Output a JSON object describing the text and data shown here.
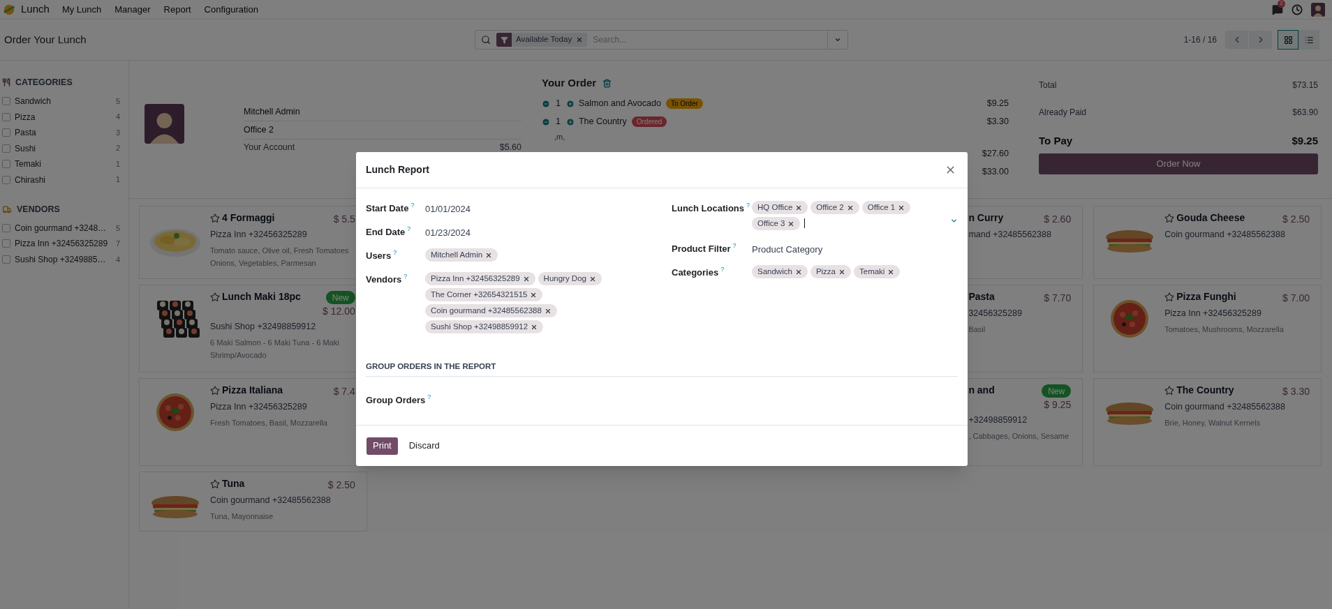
{
  "navbar": {
    "app": "Lunch",
    "menu": [
      "My Lunch",
      "Manager",
      "Report",
      "Configuration"
    ],
    "messages_badge": "2"
  },
  "control_panel": {
    "title": "Order Your Lunch",
    "search": {
      "facet": "Available Today",
      "placeholder": "Search..."
    },
    "pager": "1-16 / 16",
    "views": [
      {
        "kind": "kanban",
        "selected": true
      },
      {
        "kind": "list",
        "selected": false
      }
    ]
  },
  "sidebar": {
    "sections": [
      {
        "kind": "categories",
        "title": "CATEGORIES",
        "items": [
          {
            "label": "Sandwich",
            "count": "5",
            "checked": false
          },
          {
            "label": "Pizza",
            "count": "4",
            "checked": false
          },
          {
            "label": "Pasta",
            "count": "3",
            "checked": false
          },
          {
            "label": "Sushi",
            "count": "2",
            "checked": false
          },
          {
            "label": "Temaki",
            "count": "1",
            "checked": false
          },
          {
            "label": "Chirashi",
            "count": "1",
            "checked": false
          }
        ]
      },
      {
        "kind": "vendors",
        "title": "VENDORS",
        "items": [
          {
            "label": "Coin gourmand +3248…",
            "count": "5",
            "checked": false
          },
          {
            "label": "Pizza Inn +32456325289",
            "count": "7",
            "checked": false
          },
          {
            "label": "Sushi Shop +3249885…",
            "count": "4",
            "checked": false
          }
        ]
      }
    ]
  },
  "user": {
    "name": "Mitchell Admin",
    "location": "Office 2",
    "account_label": "Your Account",
    "account": "$5.60"
  },
  "order": {
    "title": "Your Order",
    "lines": [
      {
        "kind": "item",
        "qty": "1",
        "product": "Salmon and Avocado",
        "status": {
          "label": "To Order",
          "kind": "to_order"
        },
        "price": "$9.25"
      },
      {
        "kind": "item",
        "qty": "1",
        "product": "The Country",
        "status": {
          "label": "Ordered",
          "kind": "ordered"
        },
        "price": "$3.30",
        "note": ",m,"
      },
      {
        "kind": "covered",
        "price": "$27.60"
      },
      {
        "kind": "covered",
        "price": "$33.00"
      }
    ],
    "totals": [
      {
        "label": "Total",
        "value": "$73.15",
        "kind": "normal"
      },
      {
        "label": "Already Paid",
        "value": "$63.90",
        "kind": "normal"
      },
      {
        "label": "To Pay",
        "value": "$9.25",
        "kind": "strong"
      }
    ],
    "button": "Order Now"
  },
  "products": [
    [
      {
        "kind": "full",
        "name": "4 Formaggi",
        "favorite": false,
        "price": "$ 5.5",
        "vendor": "Pizza Inn +32456325289",
        "description": [
          "Tomato sauce, Olive oil, Fresh Tomatoes",
          "Onions, Vegetables, Parmesan"
        ]
      },
      {
        "kind": "partial",
        "name": "n Curry",
        "price": "$ 2.60",
        "vendor": "mand +32485562388"
      },
      {
        "kind": "full",
        "name": "Gouda Cheese",
        "favorite": false,
        "price": "$ 2.50",
        "vendor": "Coin gourmand +32485562388"
      }
    ],
    [
      {
        "kind": "full",
        "name": "Lunch Maki 18pc",
        "favorite": false,
        "badge": "New",
        "price": "$ 12.00",
        "vendor": "Sushi Shop +32498859912",
        "description": [
          "6 Maki Salmon - 6 Maki Tuna - 6 Maki",
          "Shrimp/Avocado"
        ]
      },
      {
        "kind": "partial",
        "name": "Pasta",
        "price": "$ 7.70",
        "vendor": "32456325289",
        "description": [
          "Basil"
        ]
      },
      {
        "kind": "full",
        "name": "Pizza Funghi",
        "favorite": false,
        "price": "$ 7.00",
        "vendor": "Pizza Inn +32456325289",
        "description": [
          "Tomatoes, Mushrooms, Mozzarella"
        ]
      }
    ],
    [
      {
        "kind": "full",
        "name": "Pizza Italiana",
        "favorite": false,
        "price": "$ 7.4",
        "vendor": "Pizza Inn +32456325289",
        "description": [
          "Fresh Tomatoes, Basil, Mozzarella"
        ]
      },
      {
        "kind": "partial",
        "name": "n and",
        "badge": "New",
        "price": "$ 9.25",
        "vendor": "+32498859912",
        "description": [
          ", Cabbages, Onions, Sesame"
        ]
      },
      {
        "kind": "full",
        "name": "The Country",
        "favorite": false,
        "price": "$ 3.30",
        "vendor": "Coin gourmand +32485562388",
        "description": [
          "Brie, Honey, Walnut Kernels"
        ]
      }
    ],
    [
      {
        "kind": "full",
        "name": "Tuna",
        "favorite": false,
        "price": "$ 2.50",
        "vendor": "Coin gourmand +32485562388",
        "description": [
          "Tuna, Mayonnaise"
        ]
      }
    ]
  ],
  "dialog": {
    "title": "Lunch Report",
    "left_fields": [
      {
        "label": "Start Date",
        "help": "?",
        "kind": "text",
        "value": "01/01/2024"
      },
      {
        "label": "End Date",
        "help": "?",
        "kind": "text",
        "value": "01/23/2024"
      },
      {
        "label": "Users",
        "help": "?",
        "kind": "tags",
        "focused": false,
        "tags": [
          "Mitchell Admin"
        ]
      },
      {
        "label": "Vendors",
        "help": "?",
        "kind": "tags",
        "focused": false,
        "tags": [
          "Pizza Inn +32456325289",
          "Hungry Dog",
          "The Corner +32654321515",
          "Coin gourmand +32485562388",
          "Sushi Shop +32498859912"
        ]
      }
    ],
    "right_fields": [
      {
        "label": "Lunch Locations",
        "help": "?",
        "kind": "tags",
        "focused": true,
        "tags": [
          "HQ Office",
          "Office 2",
          "Office 1",
          "Office 3"
        ]
      },
      {
        "label": "Product Filter",
        "help": "?",
        "kind": "text",
        "value": "Product Category"
      },
      {
        "label": "Categories",
        "help": "?",
        "kind": "tags",
        "focused": false,
        "tags": [
          "Sandwich",
          "Pizza",
          "Temaki"
        ]
      }
    ],
    "section": "GROUP ORDERS IN THE REPORT",
    "group_field": {
      "label": "Group Orders",
      "help": "?"
    },
    "buttons": [
      {
        "label": "Print",
        "kind": "primary"
      },
      {
        "label": "Discard",
        "kind": "secondary"
      }
    ]
  }
}
